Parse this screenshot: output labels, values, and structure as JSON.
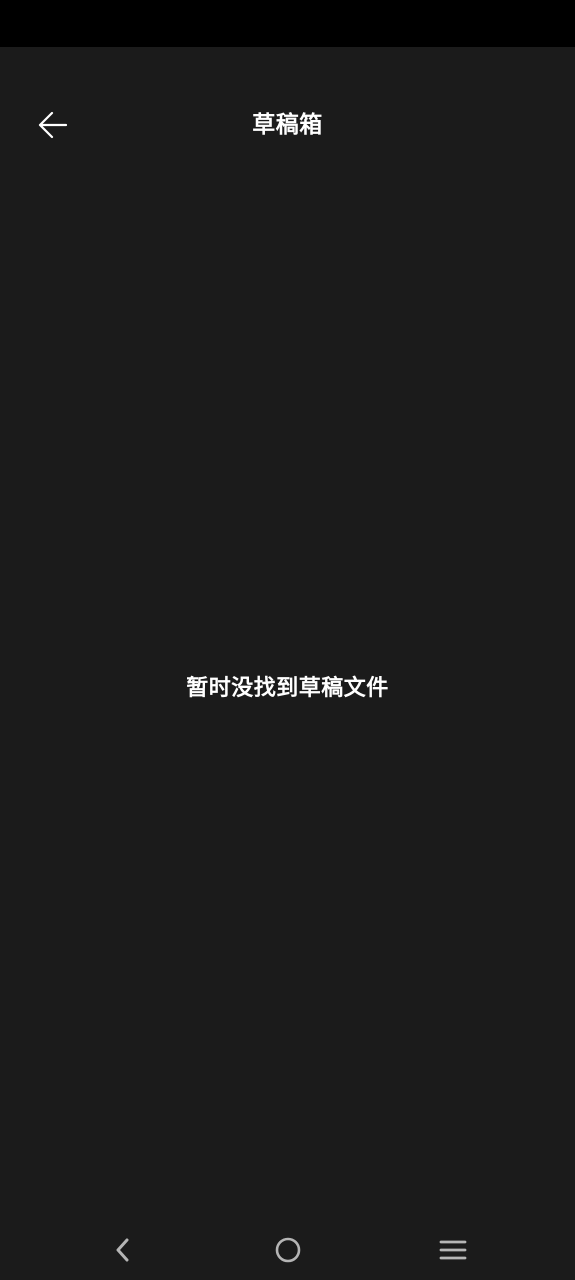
{
  "header": {
    "title": "草稿箱",
    "back_icon": "arrow-left-icon"
  },
  "main": {
    "empty_message": "暂时没找到草稿文件"
  },
  "navigation_bar": {
    "back_icon": "chevron-left-icon",
    "home_icon": "circle-home-icon",
    "menu_icon": "menu-lines-icon"
  },
  "colors": {
    "background": "#1b1b1b",
    "status_bar": "#000000",
    "text": "#ffffff",
    "nav_icons": "#b5b5b5"
  }
}
